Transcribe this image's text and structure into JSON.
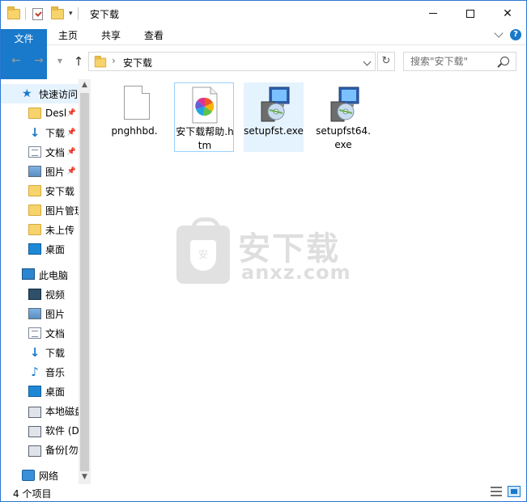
{
  "window": {
    "title": "安下载",
    "controls": {
      "minimize": "minimize",
      "maximize": "maximize",
      "close": "✕"
    }
  },
  "ribbon": {
    "tabs": [
      {
        "label": "文件",
        "active": true
      },
      {
        "label": "主页"
      },
      {
        "label": "共享"
      },
      {
        "label": "查看"
      }
    ],
    "help": "?"
  },
  "address": {
    "path": [
      "安下载"
    ],
    "separator": "›",
    "search_placeholder": "搜索\"安下载\""
  },
  "nav": {
    "quick_access": {
      "label": "快速访问"
    },
    "items": [
      {
        "label": "Desl",
        "icon": "desktop-folder-icon",
        "pinned": true
      },
      {
        "label": "下载",
        "icon": "download-icon",
        "pinned": true
      },
      {
        "label": "文档",
        "icon": "document-icon",
        "pinned": true
      },
      {
        "label": "图片",
        "icon": "picture-icon",
        "pinned": true
      },
      {
        "label": "安下载",
        "icon": "folder-icon"
      },
      {
        "label": "图片管理",
        "icon": "folder-icon"
      },
      {
        "label": "未上传",
        "icon": "folder-icon"
      },
      {
        "label": "桌面",
        "icon": "desktop-icon"
      }
    ],
    "this_pc": {
      "label": "此电脑"
    },
    "pc_items": [
      {
        "label": "视频",
        "icon": "video-icon"
      },
      {
        "label": "图片",
        "icon": "picture-icon"
      },
      {
        "label": "文档",
        "icon": "document-icon"
      },
      {
        "label": "下载",
        "icon": "download-icon"
      },
      {
        "label": "音乐",
        "icon": "music-icon"
      },
      {
        "label": "桌面",
        "icon": "desktop-icon"
      },
      {
        "label": "本地磁盘",
        "icon": "system-drive-icon"
      },
      {
        "label": "软件 (D",
        "icon": "drive-icon"
      },
      {
        "label": "备份[勿",
        "icon": "drive-icon"
      }
    ],
    "network": {
      "label": "网络"
    }
  },
  "files": [
    {
      "name": "pnghhbd.",
      "type": "blank"
    },
    {
      "name": "安下载帮助.htm",
      "type": "htm",
      "selected": true
    },
    {
      "name": "setupfst.exe",
      "type": "exe",
      "hover": true
    },
    {
      "name": "setupfst64.exe",
      "type": "exe"
    }
  ],
  "watermark": {
    "cn": "安下载",
    "en": "anxz.com",
    "badge": "安"
  },
  "status": {
    "count": "4 个项目"
  },
  "colors": {
    "accent": "#1979ca",
    "selection": "#e5f3ff",
    "selection_border": "#99d1ff"
  }
}
